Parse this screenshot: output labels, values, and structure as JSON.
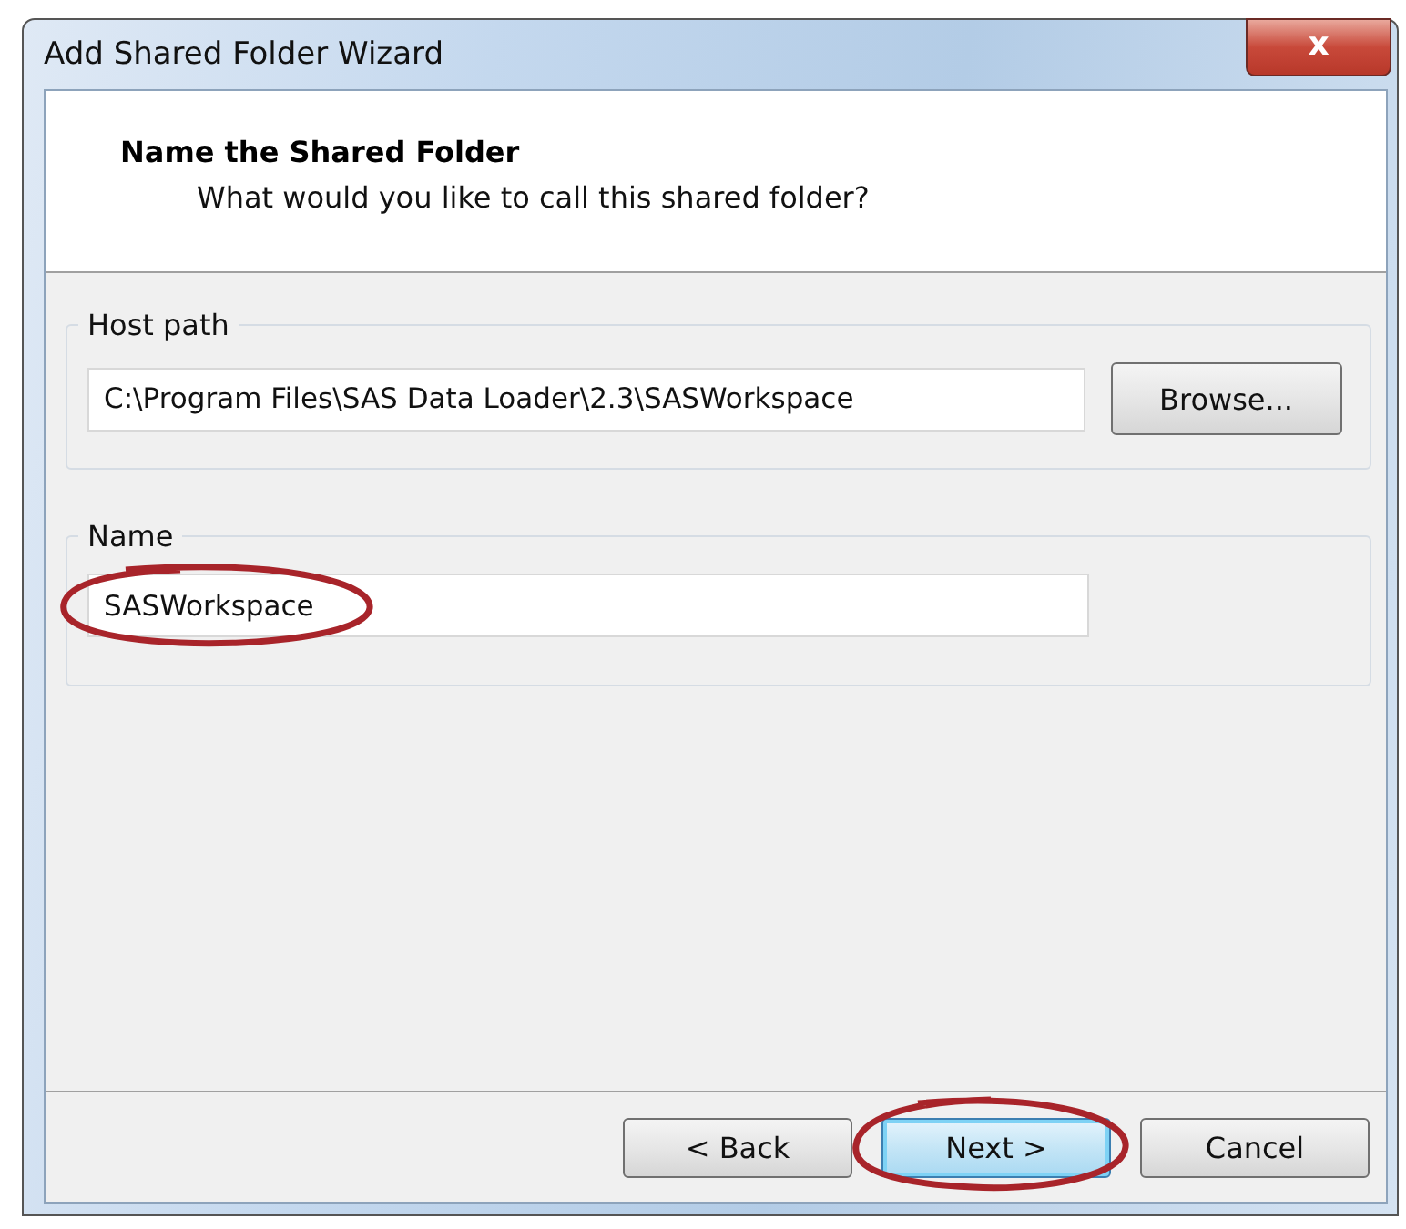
{
  "window": {
    "title": "Add Shared Folder Wizard",
    "close_glyph": "x"
  },
  "header": {
    "title": "Name the Shared Folder",
    "subtitle": "What would you like to call this shared folder?"
  },
  "host_path": {
    "label": "Host path",
    "value": "C:\\Program Files\\SAS Data Loader\\2.3\\SASWorkspace",
    "button": "Browse..."
  },
  "name": {
    "label": "Name",
    "value": "SASWorkspace",
    "circled": true
  },
  "buttons": [
    {
      "label": "< Back",
      "focused": false,
      "circled": false
    },
    {
      "label": "Next >",
      "focused": true,
      "circled": true
    },
    {
      "label": "Cancel",
      "focused": false,
      "circled": false
    }
  ]
}
